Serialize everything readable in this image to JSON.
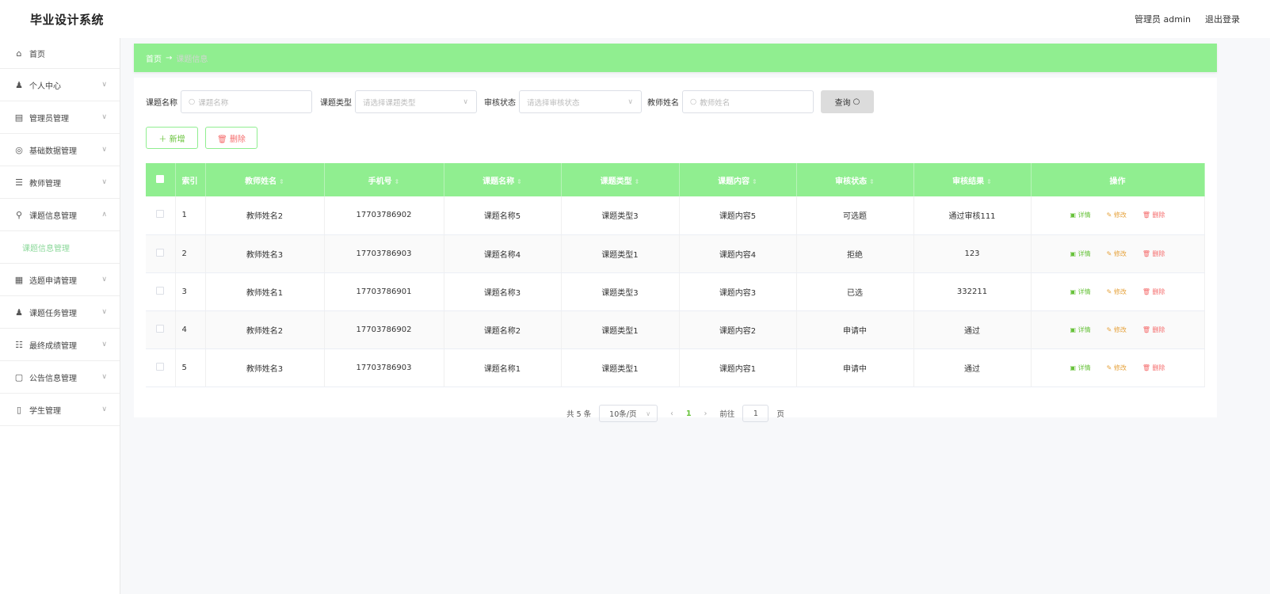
{
  "header": {
    "title": "毕业设计系统",
    "user_label": "管理员 admin",
    "logout": "退出登录"
  },
  "sidebar": {
    "items": [
      {
        "icon": "⌂",
        "label": "首页",
        "has_chevron": false
      },
      {
        "icon": "♟",
        "label": "个人中心",
        "has_chevron": true
      },
      {
        "icon": "▤",
        "label": "管理员管理",
        "has_chevron": true
      },
      {
        "icon": "◎",
        "label": "基础数据管理",
        "has_chevron": true
      },
      {
        "icon": "☰",
        "label": "教师管理",
        "has_chevron": true
      },
      {
        "icon": "⚲",
        "label": "课题信息管理",
        "has_chevron": true,
        "expanded": true
      },
      {
        "icon": "",
        "label": "课题信息管理",
        "sub": true
      },
      {
        "icon": "▦",
        "label": "选题申请管理",
        "has_chevron": true
      },
      {
        "icon": "♟",
        "label": "课题任务管理",
        "has_chevron": true
      },
      {
        "icon": "☷",
        "label": "最终成绩管理",
        "has_chevron": true
      },
      {
        "icon": "▢",
        "label": "公告信息管理",
        "has_chevron": true
      },
      {
        "icon": "▯",
        "label": "学生管理",
        "has_chevron": true
      }
    ]
  },
  "breadcrumb": {
    "home": "首页",
    "arrow": "→",
    "current": "课题信息"
  },
  "search": {
    "title_label": "课题名称",
    "title_placeholder": "课题名称",
    "type_label": "课题类型",
    "type_placeholder": "请选择课题类型",
    "status_label": "审核状态",
    "status_placeholder": "请选择审核状态",
    "teacher_label": "教师姓名",
    "teacher_placeholder": "教师姓名",
    "query_button": "查询"
  },
  "actions": {
    "add": "＋ 新增",
    "delete": "🗑 删除"
  },
  "table": {
    "headers": [
      "索引",
      "教师姓名",
      "手机号",
      "课题名称",
      "课题类型",
      "课题内容",
      "审核状态",
      "审核结果",
      "操作"
    ],
    "rows": [
      {
        "index": "1",
        "teacher": "教师姓名2",
        "phone": "17703786902",
        "title": "课题名称5",
        "type": "课题类型3",
        "content": "课题内容5",
        "status": "可选题",
        "result": "通过审核111"
      },
      {
        "index": "2",
        "teacher": "教师姓名3",
        "phone": "17703786903",
        "title": "课题名称4",
        "type": "课题类型1",
        "content": "课题内容4",
        "status": "拒绝",
        "result": "123"
      },
      {
        "index": "3",
        "teacher": "教师姓名1",
        "phone": "17703786901",
        "title": "课题名称3",
        "type": "课题类型3",
        "content": "课题内容3",
        "status": "已选",
        "result": "332211"
      },
      {
        "index": "4",
        "teacher": "教师姓名2",
        "phone": "17703786902",
        "title": "课题名称2",
        "type": "课题类型1",
        "content": "课题内容2",
        "status": "申请中",
        "result": "通过"
      },
      {
        "index": "5",
        "teacher": "教师姓名3",
        "phone": "17703786903",
        "title": "课题名称1",
        "type": "课题类型1",
        "content": "课题内容1",
        "status": "申请中",
        "result": "通过"
      }
    ],
    "row_ops": {
      "detail": "▣ 详情",
      "edit": "✎ 修改",
      "remove": "🗑 删除"
    }
  },
  "pagination": {
    "total": "共 5 条",
    "page_size": "10条/页",
    "current_page": "1",
    "goto_label": "前往",
    "goto_value": "1",
    "page_unit": "页"
  },
  "colors": {
    "accent": "#90ee90",
    "success": "#67c23a",
    "warning": "#e6a23c",
    "danger": "#f56c6c"
  }
}
